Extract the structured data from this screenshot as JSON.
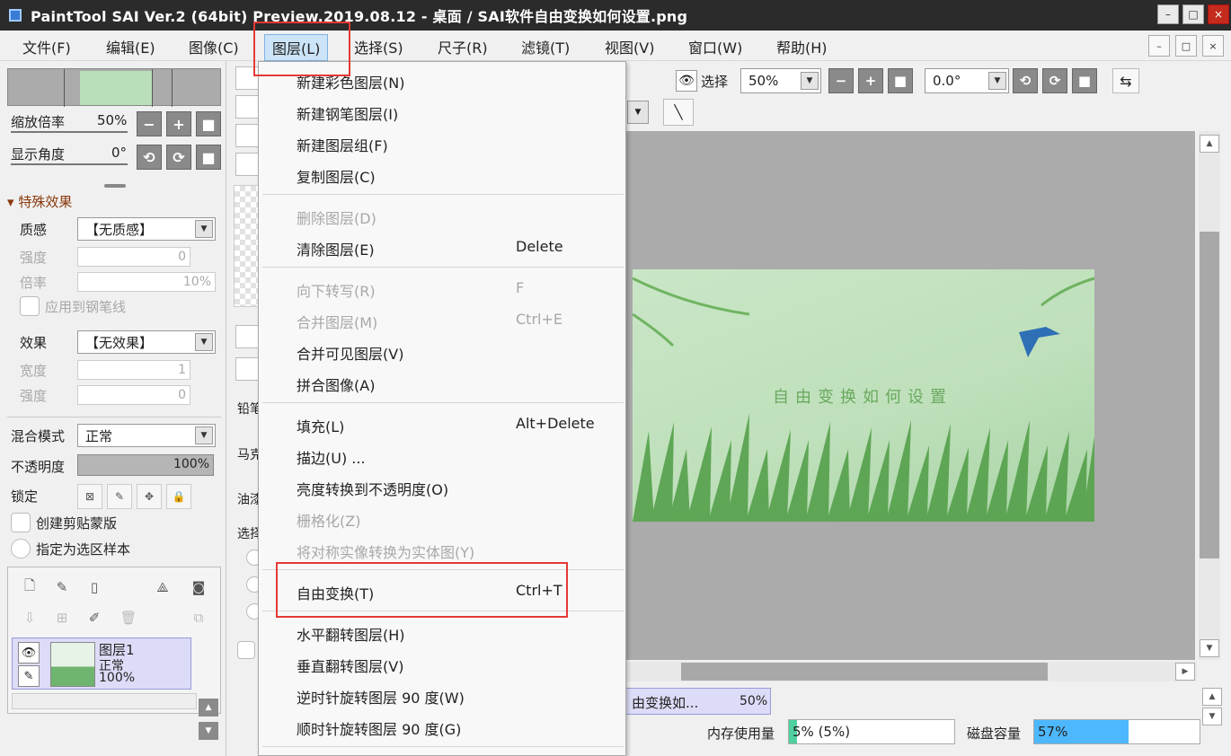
{
  "window": {
    "title": "PaintTool SAI Ver.2 (64bit) Preview.2019.08.12 - 桌面 / SAI软件自由变换如何设置.png",
    "min": "–",
    "max": "□",
    "close": "×"
  },
  "menubar": {
    "items": [
      "文件(F)",
      "编辑(E)",
      "图像(C)",
      "图层(L)",
      "选择(S)",
      "尺子(R)",
      "滤镜(T)",
      "视图(V)",
      "窗口(W)",
      "帮助(H)"
    ],
    "active": "图层(L)"
  },
  "left": {
    "zoom_label": "缩放倍率",
    "zoom_value": "50%",
    "angle_label": "显示角度",
    "angle_value": "0°",
    "minus": "−",
    "plus": "+",
    "reset": "■",
    "rot_ccw": "⟲",
    "rot_cw": "⟳",
    "effects_header": "特殊效果",
    "texture_label": "质感",
    "texture_value": "【无质感】",
    "strength_label": "强度",
    "strength_value": "0",
    "scale_label": "倍率",
    "scale_value": "10%",
    "apply_pen_label": "应用到钢笔线",
    "effect_label": "效果",
    "effect_value": "【无效果】",
    "width_label": "宽度",
    "width_value": "1",
    "strength2_label": "强度",
    "strength2_value": "0",
    "blend_label": "混合模式",
    "blend_value": "正常",
    "opacity_label": "不透明度",
    "opacity_value": "100%",
    "opacity_level": 1.0,
    "lock_label": "锁定",
    "clip_label": "创建剪贴蒙版",
    "select_sample_label": "指定为选区样本",
    "layer": {
      "name": "图层1",
      "mode": "正常",
      "opacity": "100%"
    }
  },
  "mid": {
    "frag1": "铅笔",
    "frag2": "马克",
    "frag3": "油漆",
    "frag4": "选择"
  },
  "layer_menu": {
    "items": [
      {
        "label": "新建彩色图层(N)",
        "shortcut": "",
        "enabled": true
      },
      {
        "label": "新建钢笔图层(I)",
        "shortcut": "",
        "enabled": true
      },
      {
        "label": "新建图层组(F)",
        "shortcut": "",
        "enabled": true
      },
      {
        "label": "复制图层(C)",
        "shortcut": "",
        "enabled": true
      },
      {
        "label": "删除图层(D)",
        "shortcut": "",
        "enabled": false
      },
      {
        "label": "清除图层(E)",
        "shortcut": "Delete",
        "enabled": true
      },
      {
        "label": "向下转写(R)",
        "shortcut": "F",
        "enabled": false
      },
      {
        "label": "合并图层(M)",
        "shortcut": "Ctrl+E",
        "enabled": false
      },
      {
        "label": "合并可见图层(V)",
        "shortcut": "",
        "enabled": true
      },
      {
        "label": "拼合图像(A)",
        "shortcut": "",
        "enabled": true
      },
      {
        "label": "填充(L)",
        "shortcut": "Alt+Delete",
        "enabled": true
      },
      {
        "label": "描边(U) ...",
        "shortcut": "",
        "enabled": true
      },
      {
        "label": "亮度转换到不透明度(O)",
        "shortcut": "",
        "enabled": true
      },
      {
        "label": "栅格化(Z)",
        "shortcut": "",
        "enabled": false
      },
      {
        "label": "将对称实像转换为实体图(Y)",
        "shortcut": "",
        "enabled": false
      },
      {
        "label": "自由变换(T)",
        "shortcut": "Ctrl+T",
        "enabled": true
      },
      {
        "label": "水平翻转图层(H)",
        "shortcut": "",
        "enabled": true
      },
      {
        "label": "垂直翻转图层(V)",
        "shortcut": "",
        "enabled": true
      },
      {
        "label": "逆时针旋转图层 90 度(W)",
        "shortcut": "",
        "enabled": true
      },
      {
        "label": "顺时针旋转图层 90 度(G)",
        "shortcut": "",
        "enabled": true
      }
    ]
  },
  "toolbar": {
    "select_label": "选择",
    "zoom_value": "50%",
    "angle_value": "0.0°",
    "minus": "−",
    "plus": "+",
    "reset": "■",
    "rot_ccw": "⟲",
    "rot_cw": "⟳",
    "swap": "⇆",
    "line": "╲"
  },
  "canvas": {
    "image_text": "自由变换如何设置"
  },
  "doc_tab": {
    "name": "由变换如...",
    "zoom": "50%"
  },
  "status": {
    "mem_label": "内存使用量",
    "mem_value": "5% (5%)",
    "mem_level": 0.05,
    "disk_label": "磁盘容量",
    "disk_value": "57%",
    "disk_level": 0.57
  },
  "colors": {
    "accent": "#cce4f7",
    "highlight": "#e53935",
    "mem_fill": "#4fd0a0",
    "disk_fill": "#4db8ff"
  }
}
